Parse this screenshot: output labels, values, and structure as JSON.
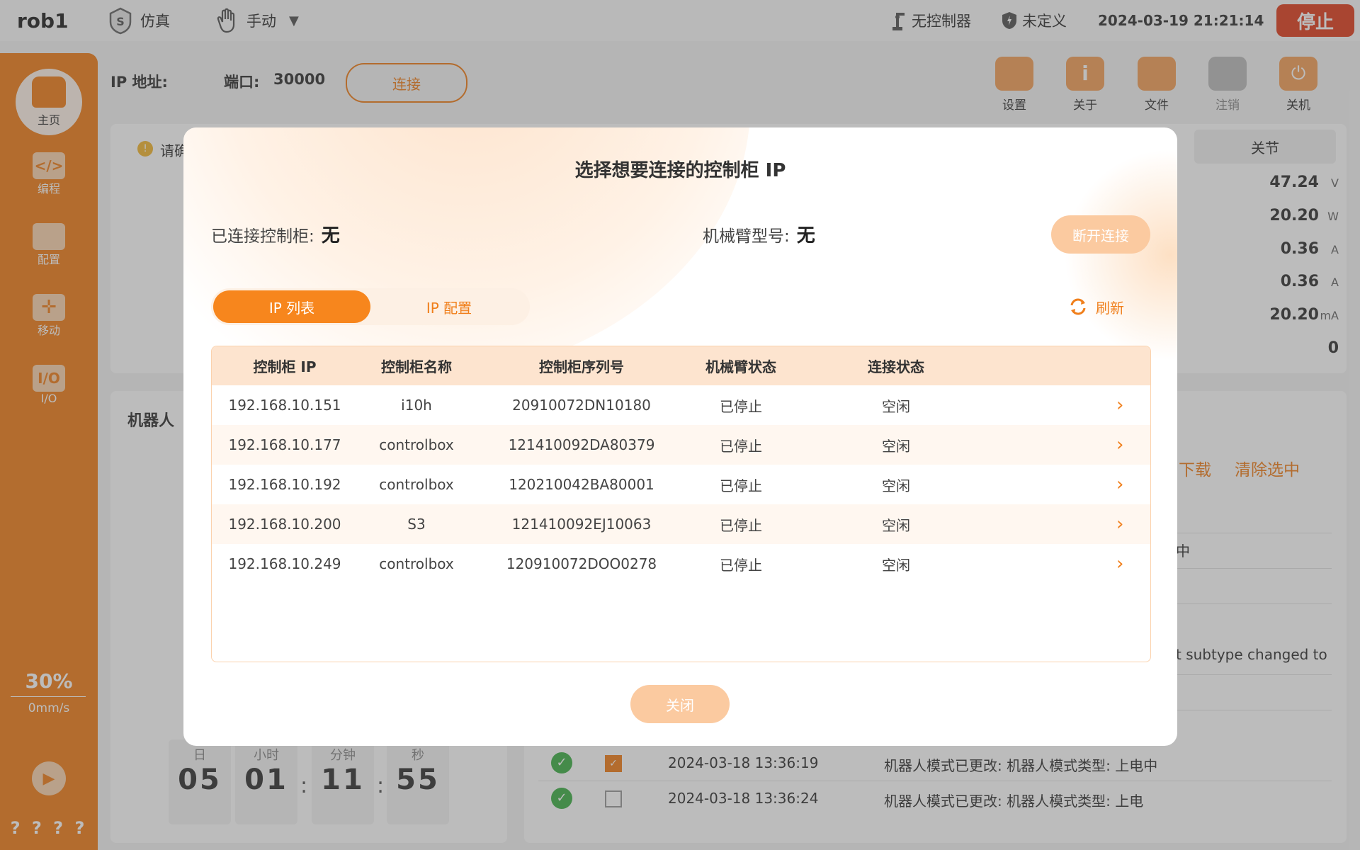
{
  "topbar": {
    "robot_name": "rob1",
    "sim_label": "仿真",
    "mode_label": "手动",
    "controller_status": "无控制器",
    "safety_status": "未定义",
    "datetime": "2024-03-19 21:21:14",
    "stop_label": "停止"
  },
  "sidebar": {
    "home": "主页",
    "program": "编程",
    "config": "配置",
    "move": "移动",
    "io": "I/O",
    "speed_percent": "30%",
    "speed_value": "0mm/s",
    "bottom_marks": "? ? ? ?"
  },
  "header": {
    "ip_label": "IP 地址:",
    "port_label": "端口:",
    "port_value": "30000",
    "connect_label": "连接",
    "icons": [
      {
        "label": "设置"
      },
      {
        "label": "关于"
      },
      {
        "label": "文件"
      },
      {
        "label": "注销"
      },
      {
        "label": "关机"
      }
    ]
  },
  "background": {
    "notice": "请确",
    "joint_tab": "关节",
    "metrics": [
      {
        "value": "47.24",
        "unit": "V"
      },
      {
        "value": "20.20",
        "unit": "W"
      },
      {
        "value": "0.36",
        "unit": "A"
      },
      {
        "value": "0.36",
        "unit": "A"
      },
      {
        "value": "20.20",
        "unit": "mA"
      },
      {
        "value": "0",
        "unit": ""
      }
    ],
    "robot_section": "机器人",
    "download": "下载",
    "clear_selected": "清除选中",
    "log_partial": [
      "中",
      "t subtype changed to"
    ],
    "timer": {
      "day_label": "日",
      "day": "05",
      "hour_label": "小时",
      "hour": "01",
      "min_label": "分钟",
      "min": "11",
      "sec_label": "秒",
      "sec": "55"
    },
    "logs": [
      {
        "time": "2024-03-18 13:36:19",
        "msg": "机器人模式已更改: 机器人模式类型: 上电中",
        "checked": true
      },
      {
        "time": "2024-03-18 13:36:24",
        "msg": "机器人模式已更改: 机器人模式类型: 上电",
        "checked": false
      }
    ]
  },
  "dialog": {
    "title": "选择想要连接的控制柜 IP",
    "connected_label": "已连接控制柜:",
    "connected_value": "无",
    "arm_label": "机械臂型号:",
    "arm_value": "无",
    "disconnect_label": "断开连接",
    "tab_list": "IP 列表",
    "tab_config": "IP 配置",
    "refresh_label": "刷新",
    "columns": [
      "控制柜 IP",
      "控制柜名称",
      "控制柜序列号",
      "机械臂状态",
      "连接状态"
    ],
    "rows": [
      {
        "ip": "192.168.10.151",
        "name": "i10h",
        "serial": "20910072DN10180",
        "arm": "已停止",
        "conn": "空闲"
      },
      {
        "ip": "192.168.10.177",
        "name": "controlbox",
        "serial": "121410092DA80379",
        "arm": "已停止",
        "conn": "空闲"
      },
      {
        "ip": "192.168.10.192",
        "name": "controlbox",
        "serial": "120210042BA80001",
        "arm": "已停止",
        "conn": "空闲"
      },
      {
        "ip": "192.168.10.200",
        "name": "S3",
        "serial": "121410092EJ10063",
        "arm": "已停止",
        "conn": "空闲"
      },
      {
        "ip": "192.168.10.249",
        "name": "controlbox",
        "serial": "120910072DOO0278",
        "arm": "已停止",
        "conn": "空闲"
      }
    ],
    "close_label": "关闭"
  }
}
